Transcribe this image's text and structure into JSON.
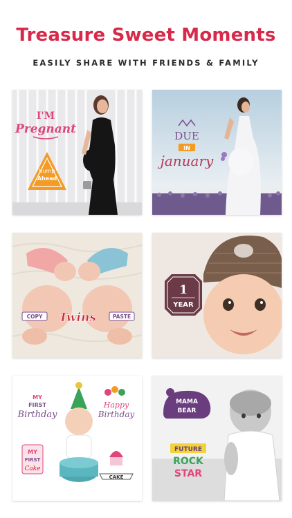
{
  "header": {
    "title": "Treasure Sweet Moments",
    "subtitle": "EASILY SHARE WITH FRIENDS & FAMILY"
  },
  "tiles": [
    {
      "stickers": {
        "main_top": "I'M",
        "main_bottom": "Pregnant",
        "badge_top": "bump",
        "badge_bottom": "Ahead"
      }
    },
    {
      "stickers": {
        "line1": "DUE",
        "line2": "IN",
        "line3": "january"
      }
    },
    {
      "stickers": {
        "left": "COPY",
        "center": "Twins",
        "right": "PASTE"
      }
    },
    {
      "stickers": {
        "number": "1",
        "label": "YEAR"
      }
    },
    {
      "stickers": {
        "a1": "MY",
        "a2": "FIRST",
        "a3": "Birthday",
        "b1": "Happy",
        "b2": "Birthday",
        "c1": "MY",
        "c2": "FIRST",
        "c3": "Cake",
        "d1": "CAKE"
      }
    },
    {
      "stickers": {
        "a1": "MAMA",
        "a2": "BEAR",
        "b1": "FUTURE",
        "b2": "ROCK",
        "b3": "STAR"
      }
    }
  ],
  "colors": {
    "headline": "#d8294a",
    "subtitle": "#2b2b2b",
    "pregnant_pink": "#e0457b",
    "bump_orange": "#f39b25",
    "due_purple": "#7a4e8c",
    "year_badge": "#6b3a47",
    "twins_red": "#c8283a"
  }
}
